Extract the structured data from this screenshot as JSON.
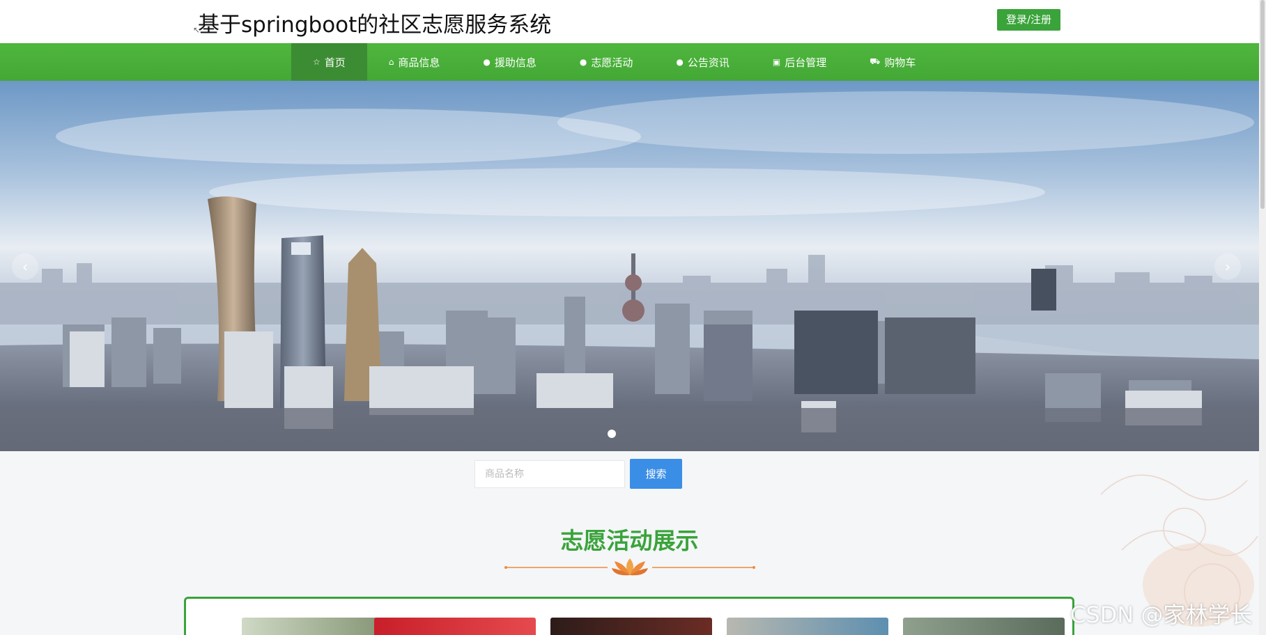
{
  "header": {
    "title": "基于springboot的社区志愿服务系统",
    "login_label": "登录/注册"
  },
  "nav": {
    "items": [
      {
        "label": "首页",
        "icon": "star-icon"
      },
      {
        "label": "商品信息",
        "icon": "bag-icon"
      },
      {
        "label": "援助信息",
        "icon": "exclamation-icon"
      },
      {
        "label": "志愿活动",
        "icon": "question-icon"
      },
      {
        "label": "公告资讯",
        "icon": "info-icon"
      },
      {
        "label": "后台管理",
        "icon": "briefcase-icon"
      },
      {
        "label": "购物车",
        "icon": "cart-icon"
      }
    ],
    "active_index": 0
  },
  "banner": {
    "prev_icon": "chevron-left-icon",
    "next_icon": "chevron-right-icon",
    "slide_count": 1,
    "active_slide": 0
  },
  "search": {
    "placeholder": "商品名称",
    "button_label": "搜索"
  },
  "section": {
    "title": "志愿活动展示"
  },
  "watermark": "CSDN @家林学长",
  "colors": {
    "primary_green": "#3aa33a",
    "nav_green": "#4fb63e",
    "search_blue": "#3a8ee6",
    "divider_orange": "#ee8a3c"
  }
}
